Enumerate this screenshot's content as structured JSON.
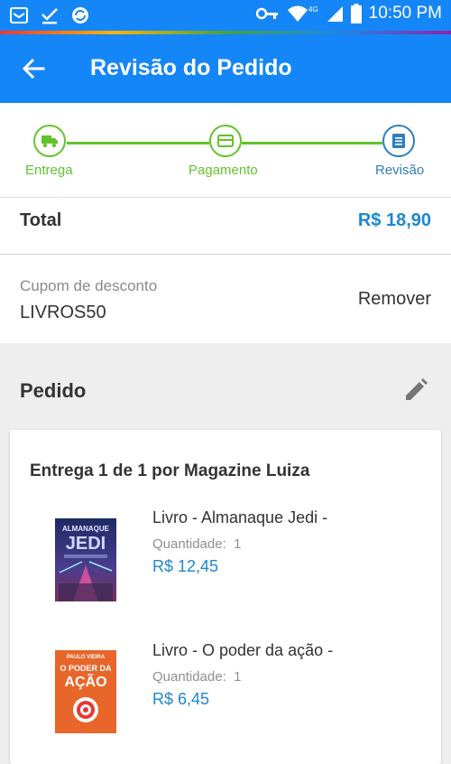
{
  "status_bar": {
    "time": "10:50 PM",
    "network": "4G",
    "icons": [
      "gallery-icon",
      "download-done-icon",
      "sync-icon",
      "key-icon",
      "wifi-icon",
      "signal-icon",
      "battery-icon"
    ]
  },
  "header": {
    "title": "Revisão do Pedido",
    "back_icon": "arrow-back-icon"
  },
  "steps": [
    {
      "label": "Entrega",
      "icon": "truck-icon",
      "state": "done"
    },
    {
      "label": "Pagamento",
      "icon": "card-icon",
      "state": "done"
    },
    {
      "label": "Revisão",
      "icon": "list-icon",
      "state": "current"
    }
  ],
  "total": {
    "label": "Total",
    "value": "R$ 18,90"
  },
  "coupon": {
    "label": "Cupom de desconto",
    "code": "LIVROS50",
    "remove_label": "Remover"
  },
  "order": {
    "title": "Pedido",
    "edit_icon": "pencil-icon",
    "delivery_title": "Entrega 1 de 1 por Magazine Luiza",
    "items": [
      {
        "name": "Livro - Almanaque Jedi -",
        "qty_label": "Quantidade:",
        "qty": "1",
        "price": "R$ 12,45",
        "cover_title": "ALMANAQUE JEDI"
      },
      {
        "name": "Livro - O poder da ação -",
        "qty_label": "Quantidade:",
        "qty": "1",
        "price": "R$ 6,45",
        "cover_title": "O PODER DA AÇÃO",
        "cover_author": "PAULO VIEIRA"
      }
    ]
  },
  "colors": {
    "primary": "#1586f7",
    "step_done": "#62c32c",
    "step_current": "#2d7fbc",
    "price": "#1d87d0"
  }
}
